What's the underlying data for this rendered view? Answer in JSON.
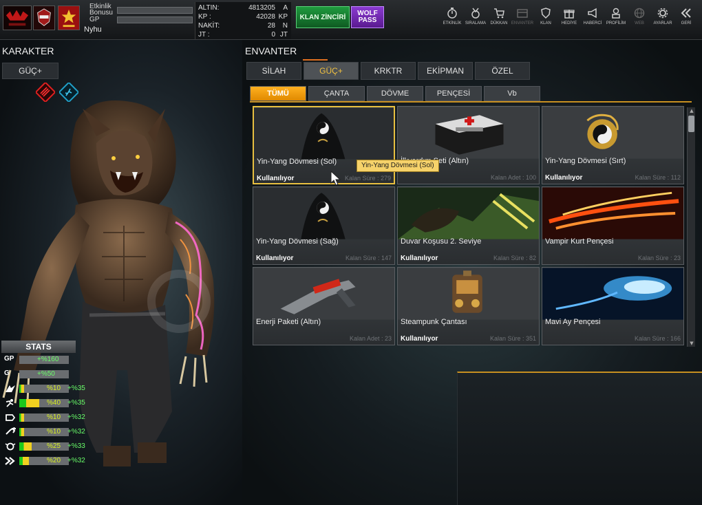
{
  "topbar": {
    "bonus_label": "Etkinlik\nBonusu",
    "bonus_label_1": "Etkinlik",
    "bonus_label_2": "Bonusu",
    "gp_label": "GP",
    "character_name": "Nyhu",
    "currency": [
      {
        "label": "ALTIN:",
        "value": "4813205",
        "unit": "A"
      },
      {
        "label": "KP :",
        "value": "42028",
        "unit": "KP"
      },
      {
        "label": "NAKİT:",
        "value": "28",
        "unit": "N"
      },
      {
        "label": "JT :",
        "value": "0",
        "unit": "JT"
      }
    ],
    "klan_button": "KLAN ZİNCİRİ",
    "wolf_pass_button": "WOLF PASS",
    "nav": [
      {
        "label": "ETKİNLİK",
        "icon": "stopwatch-icon"
      },
      {
        "label": "SIRALAMA",
        "icon": "medal-icon"
      },
      {
        "label": "DÜKKAN",
        "icon": "cart-icon"
      },
      {
        "label": "ENVANTER",
        "icon": "inventory-icon"
      },
      {
        "label": "KLAN",
        "icon": "shield-icon"
      },
      {
        "label": "HEDİYE",
        "icon": "gift-icon"
      },
      {
        "label": "HABERCİ",
        "icon": "megaphone-icon"
      },
      {
        "label": "PROFİLİM",
        "icon": "profile-icon"
      },
      {
        "label": "WEB",
        "icon": "globe-icon"
      },
      {
        "label": "AYARLAR",
        "icon": "gear-icon"
      },
      {
        "label": "GERİ",
        "icon": "back-arrows-icon"
      }
    ]
  },
  "character": {
    "title": "KARAKTER",
    "tab": "GÜÇ+",
    "stats_title": "STATS",
    "stats": [
      {
        "icon": "GP",
        "fill": 0,
        "value": "+%160"
      },
      {
        "icon": "G",
        "fill": 0,
        "value": "+%50"
      },
      {
        "icon": "attack-icon",
        "fill": 0.1,
        "pct": "%10",
        "value": "+%35"
      },
      {
        "icon": "speed-icon",
        "fill": 0.4,
        "pct": "%40",
        "value": "+%35"
      },
      {
        "icon": "defense-icon",
        "fill": 0.1,
        "pct": "%10",
        "value": "+%32"
      },
      {
        "icon": "health-icon",
        "fill": 0.1,
        "pct": "%10",
        "value": "+%32"
      },
      {
        "icon": "skill-icon",
        "fill": 0.25,
        "pct": "%25",
        "value": "+%33"
      },
      {
        "icon": "dash-icon",
        "fill": 0.2,
        "pct": "%20",
        "value": "+%32"
      }
    ]
  },
  "inventory": {
    "title": "ENVANTER",
    "tabs": [
      "SİLAH",
      "GÜÇ+",
      "KRKTR",
      "EKİPMAN",
      "ÖZEL"
    ],
    "active_tab": "GÜÇ+",
    "subtabs": [
      "TÜMÜ",
      "ÇANTA",
      "DÖVME",
      "PENÇESİ",
      "Vb"
    ],
    "active_subtab": "TÜMÜ",
    "items": [
      {
        "name": "Yin-Yang Dövmesi (Sol)",
        "status": "Kullanılıyor",
        "remaining": "Kalan Süre : 279",
        "art": "yinyang"
      },
      {
        "name": "İlkyardım Seti (Altın)",
        "status": "",
        "remaining": "Kalan Adet : 100",
        "art": "medkit"
      },
      {
        "name": "Yin-Yang Dövmesi (Sırt)",
        "status": "Kullanılıyor",
        "remaining": "Kalan Süre : 112",
        "art": "dragon"
      },
      {
        "name": "Yin-Yang Dövmesi (Sağ)",
        "status": "Kullanılıyor",
        "remaining": "Kalan Süre : 147",
        "art": "yinyang"
      },
      {
        "name": "Duvar Koşusu 2. Seviye",
        "status": "Kullanılıyor",
        "remaining": "Kalan Süre : 82",
        "art": "wolfrun"
      },
      {
        "name": "Vampir Kurt Pençesi",
        "status": "",
        "remaining": "Kalan Süre : 23",
        "art": "redclaw"
      },
      {
        "name": "Enerji Paketi (Altın)",
        "status": "",
        "remaining": "Kalan Adet : 23",
        "art": "gun"
      },
      {
        "name": "Steampunk Çantası",
        "status": "Kullanılıyor",
        "remaining": "Kalan Süre : 351",
        "art": "backpack"
      },
      {
        "name": "Mavi Ay Pençesi",
        "status": "",
        "remaining": "Kalan Süre : 166",
        "art": "blueclaw"
      }
    ],
    "tooltip": "Yin-Yang Dövmesi (Sol)"
  },
  "colors": {
    "accent": "#e8a010",
    "active_tab_text": "#f0c040",
    "stat_green": "#6aff6a",
    "stat_yellow": "#d8f020"
  }
}
